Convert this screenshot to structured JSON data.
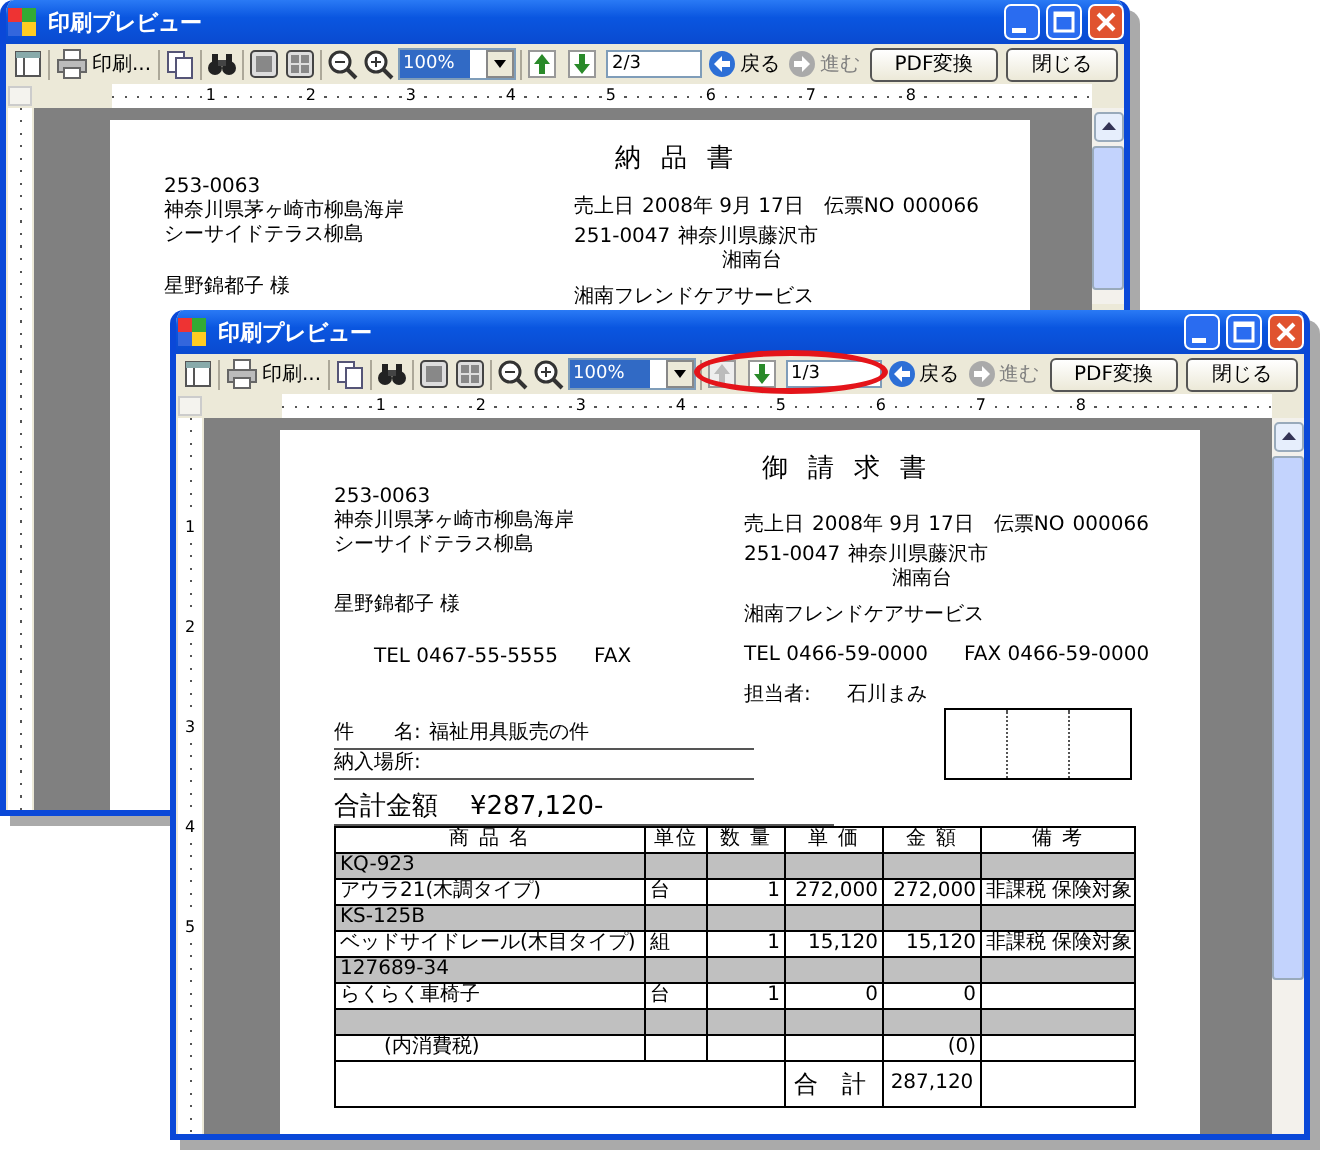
{
  "windows": [
    {
      "title": "印刷プレビュー",
      "highlight_page_field": false,
      "toolbar": {
        "print": "印刷...",
        "zoom": "100%",
        "page": "2/3",
        "page_up_disabled": false,
        "back": "戻る",
        "forward": "進む",
        "forward_disabled": true,
        "pdf": "PDF変換",
        "close": "閉じる"
      },
      "ruler_labels": [
        "1",
        "2",
        "3",
        "4",
        "5",
        "6",
        "7",
        "8"
      ],
      "document": {
        "kind": "delivery_note",
        "title": "納 品 書",
        "recipient": {
          "postal": "253-0063",
          "address": [
            "神奈川県茅ヶ崎市柳島海岸",
            "シーサイドテラス柳島"
          ],
          "name": "星野錦都子 様"
        },
        "sender": {
          "date_label": "売上日",
          "date": "2008年 9月 17日",
          "slip_label": "伝票NO",
          "slip_no": "000066",
          "postal": "251-0047",
          "address": [
            "神奈川県藤沢市",
            "湘南台"
          ],
          "company": "湘南フレンドケアサービス"
        }
      }
    },
    {
      "title": "印刷プレビュー",
      "highlight_page_field": true,
      "toolbar": {
        "print": "印刷...",
        "zoom": "100%",
        "page": "1/3",
        "page_up_disabled": true,
        "back": "戻る",
        "forward": "進む",
        "forward_disabled": true,
        "pdf": "PDF変換",
        "close": "閉じる"
      },
      "ruler_labels": [
        "1",
        "2",
        "3",
        "4",
        "5",
        "6",
        "7",
        "8"
      ],
      "vertical_ruler_labels": [
        "1",
        "2",
        "3",
        "4",
        "5"
      ],
      "document": {
        "kind": "invoice",
        "title": "御 請 求 書",
        "recipient": {
          "postal": "253-0063",
          "address": [
            "神奈川県茅ヶ崎市柳島海岸",
            "シーサイドテラス柳島"
          ],
          "name": "星野錦都子 様",
          "tel": "TEL 0467-55-5555",
          "fax": "FAX"
        },
        "sender": {
          "date_label": "売上日",
          "date": "2008年 9月 17日",
          "slip_label": "伝票NO",
          "slip_no": "000066",
          "postal": "251-0047",
          "address": [
            "神奈川県藤沢市",
            "湘南台"
          ],
          "company": "湘南フレンドケアサービス",
          "tel": "TEL 0466-59-0000",
          "fax": "FAX 0466-59-0000",
          "staff_label": "担当者:",
          "staff": "石川まみ"
        },
        "subject_label": "件　　名:",
        "subject": "福祉用具販売の件",
        "delivery_label": "納入場所:",
        "total_label": "合計金額",
        "total": "¥287,120-",
        "table": {
          "columns": [
            "商 品 名",
            "単位",
            "数 量",
            "単 価",
            "金 額",
            "備 考"
          ],
          "rows": [
            {
              "kind": "code",
              "name": "KQ-923"
            },
            {
              "kind": "item",
              "name": "アウラ21(木調タイプ)",
              "unit": "台",
              "qty": "1",
              "price": "272,000",
              "amount": "272,000",
              "note": "非課税 保険対象"
            },
            {
              "kind": "code",
              "name": "KS-125B"
            },
            {
              "kind": "item",
              "name": "ベッドサイドレール(木目タイプ)",
              "unit": "組",
              "qty": "1",
              "price": "15,120",
              "amount": "15,120",
              "note": "非課税 保険対象"
            },
            {
              "kind": "code",
              "name": "127689-34"
            },
            {
              "kind": "item",
              "name": "らくらく車椅子",
              "unit": "台",
              "qty": "1",
              "price": "0",
              "amount": "0"
            },
            {
              "kind": "blank"
            },
            {
              "kind": "tax",
              "name": "(内消費税)",
              "amount": "(0)"
            },
            {
              "kind": "total",
              "label": "合 計",
              "amount": "287,120"
            }
          ]
        }
      }
    }
  ]
}
